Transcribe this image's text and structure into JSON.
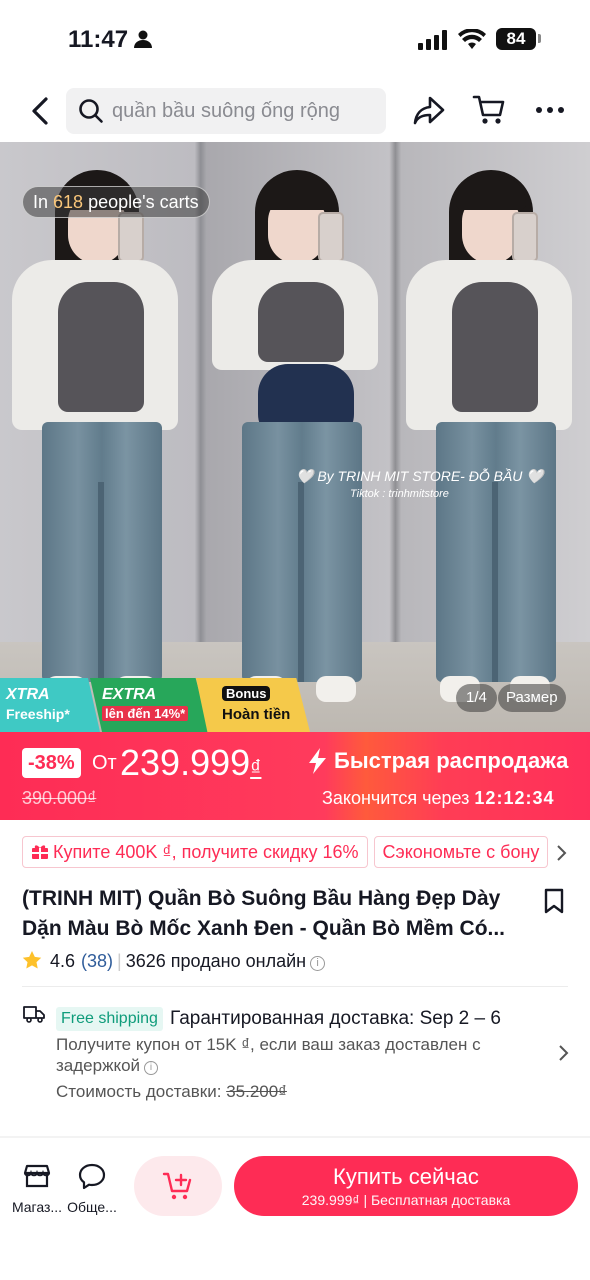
{
  "status": {
    "time": "11:47",
    "battery": "84"
  },
  "nav": {
    "search_query": "quần bầu suông ống rộng"
  },
  "hero": {
    "carts_prefix": "In",
    "carts_count": "618",
    "carts_suffix": "people's carts",
    "watermark": "🤍 By TRINH MIT STORE- ĐỖ BẦU 🤍",
    "watermark_sub": "Tiktok : trinhmitstore",
    "counter": "1/4",
    "size_button": "Размер"
  },
  "promo": {
    "xtra_title": "XTRA",
    "xtra_sub": "Freeship*",
    "extra_title": "EXTRA",
    "extra_sub": "lên đến 14%*",
    "bonus_title": "Bonus",
    "bonus_sub": "Hoàn tiền"
  },
  "price": {
    "discount": "-38%",
    "from": "От",
    "value": "239.999",
    "currency": "₫",
    "old": "390.000₫",
    "flash_sale": "Быстрая распродажа",
    "ends_label": "Закончится через",
    "timer": "12:12:34"
  },
  "coupons": [
    "Купите 400K ₫, получите скидку 16%",
    "Сэкономьте с бону"
  ],
  "product": {
    "title": "(TRINH MIT) Quần Bò Suông Bầu Hàng Đẹp Dày Dặn Màu Bò Mốc Xanh Đen - Quần Bò Mềm Có...",
    "rating": "4.6",
    "reviews": "(38)",
    "sold": "3626 продано онлайн"
  },
  "shipping": {
    "free_tag": "Free shipping",
    "guarantee": "Гарантированная доставка: Sep 2 – 6",
    "coupon_note": "Получите купон от 15K ₫, если ваш заказ доставлен с задержкой",
    "cost_label": "Стоимость доставки:",
    "cost_value": "35.200₫"
  },
  "bottom": {
    "store_label": "Магаз...",
    "chat_label": "Обще...",
    "buy_label": "Купить сейчас",
    "buy_sub": "239.999₫ | Бесплатная доставка"
  },
  "colors": {
    "accent": "#fe2c55",
    "teal": "#0f9c7b"
  }
}
